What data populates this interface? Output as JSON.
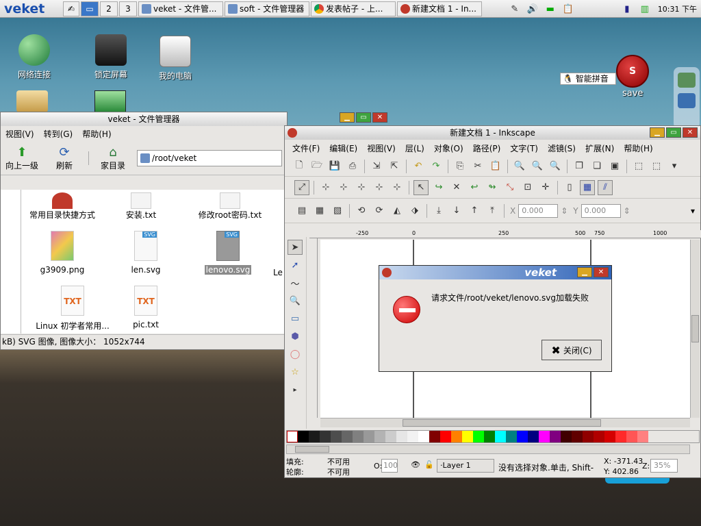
{
  "taskbar": {
    "logo": "veket",
    "workspaces": [
      "1",
      "2",
      "3"
    ],
    "tasks": [
      {
        "label": "veket - 文件管...",
        "icon": "folder-icon"
      },
      {
        "label": "soft - 文件管理器",
        "icon": "folder-icon"
      },
      {
        "label": "发表帖子 - 上...",
        "icon": "chrome-icon"
      },
      {
        "label": "新建文档 1 - In...",
        "icon": "inkscape-icon"
      }
    ],
    "clock": "10:31 下午"
  },
  "desktop": {
    "icons": [
      {
        "label": "网络连接"
      },
      {
        "label": "锁定屏幕"
      },
      {
        "label": "我的电脑"
      }
    ],
    "ime": "智能拼音",
    "save_label": "save",
    "save_badge": "S"
  },
  "filemanager": {
    "title": "veket - 文件管理器",
    "menu": [
      "视图(V)",
      "转到(G)",
      "帮助(H)"
    ],
    "toolbar": {
      "up": "向上一级",
      "refresh": "刷新",
      "home": "家目录"
    },
    "path": "/root/veket",
    "files": [
      {
        "name": "常用目录快捷方式",
        "kind": "shortcut"
      },
      {
        "name": "安装.txt",
        "kind": "txt"
      },
      {
        "name": "修改root密码.txt",
        "kind": "txt"
      },
      {
        "name": "g3909.png",
        "kind": "png"
      },
      {
        "name": "len.svg",
        "kind": "svg"
      },
      {
        "name": "lenovo.svg",
        "kind": "svg",
        "selected": true
      },
      {
        "name": "Le",
        "kind": "partial"
      },
      {
        "name": "Linux 初学者常用...",
        "kind": "txt"
      },
      {
        "name": "pic.txt",
        "kind": "txt"
      }
    ],
    "status": "kB) SVG 图像, 图像大小： 1052x744"
  },
  "inkscape": {
    "title": "新建文档 1 - Inkscape",
    "menu": [
      "文件(F)",
      "编辑(E)",
      "视图(V)",
      "层(L)",
      "对象(O)",
      "路径(P)",
      "文字(T)",
      "滤镜(S)",
      "扩展(N)",
      "帮助(H)"
    ],
    "x_label": "X",
    "x_value": "0.000",
    "y_label": "Y",
    "y_value": "0.000",
    "ruler": [
      "-250",
      "0",
      "250",
      "500",
      "750",
      "1000"
    ],
    "status": {
      "fill_label": "填充:",
      "fill_value": "不可用",
      "stroke_label": "轮廓:",
      "stroke_value": "不可用",
      "opacity_label": "O:",
      "opacity_value": "100",
      "layer": "·Layer 1",
      "message": "没有选择对象.单击, Shift-",
      "x_coord": "X: -371.43",
      "y_coord": "Y: 402.86",
      "zoom_label": "Z:",
      "zoom_value": "35%"
    }
  },
  "dialog": {
    "title": "veket",
    "message": "请求文件/root/veket/lenovo.svg加载失败",
    "close_label": "关闭(C)"
  },
  "palette": [
    "#000000",
    "#1a1a1a",
    "#333333",
    "#4d4d4d",
    "#666666",
    "#808080",
    "#999999",
    "#b3b3b3",
    "#cccccc",
    "#e6e6e6",
    "#f2f2f2",
    "#ffffff",
    "#800000",
    "#ff0000",
    "#ff8000",
    "#ffff00",
    "#00ff00",
    "#008000",
    "#00ffff",
    "#008080",
    "#0000ff",
    "#000080",
    "#ff00ff",
    "#800080",
    "#400000",
    "#600000",
    "#900000",
    "#b00000",
    "#d40000",
    "#ff2a2a",
    "#ff5555",
    "#ff8080"
  ]
}
